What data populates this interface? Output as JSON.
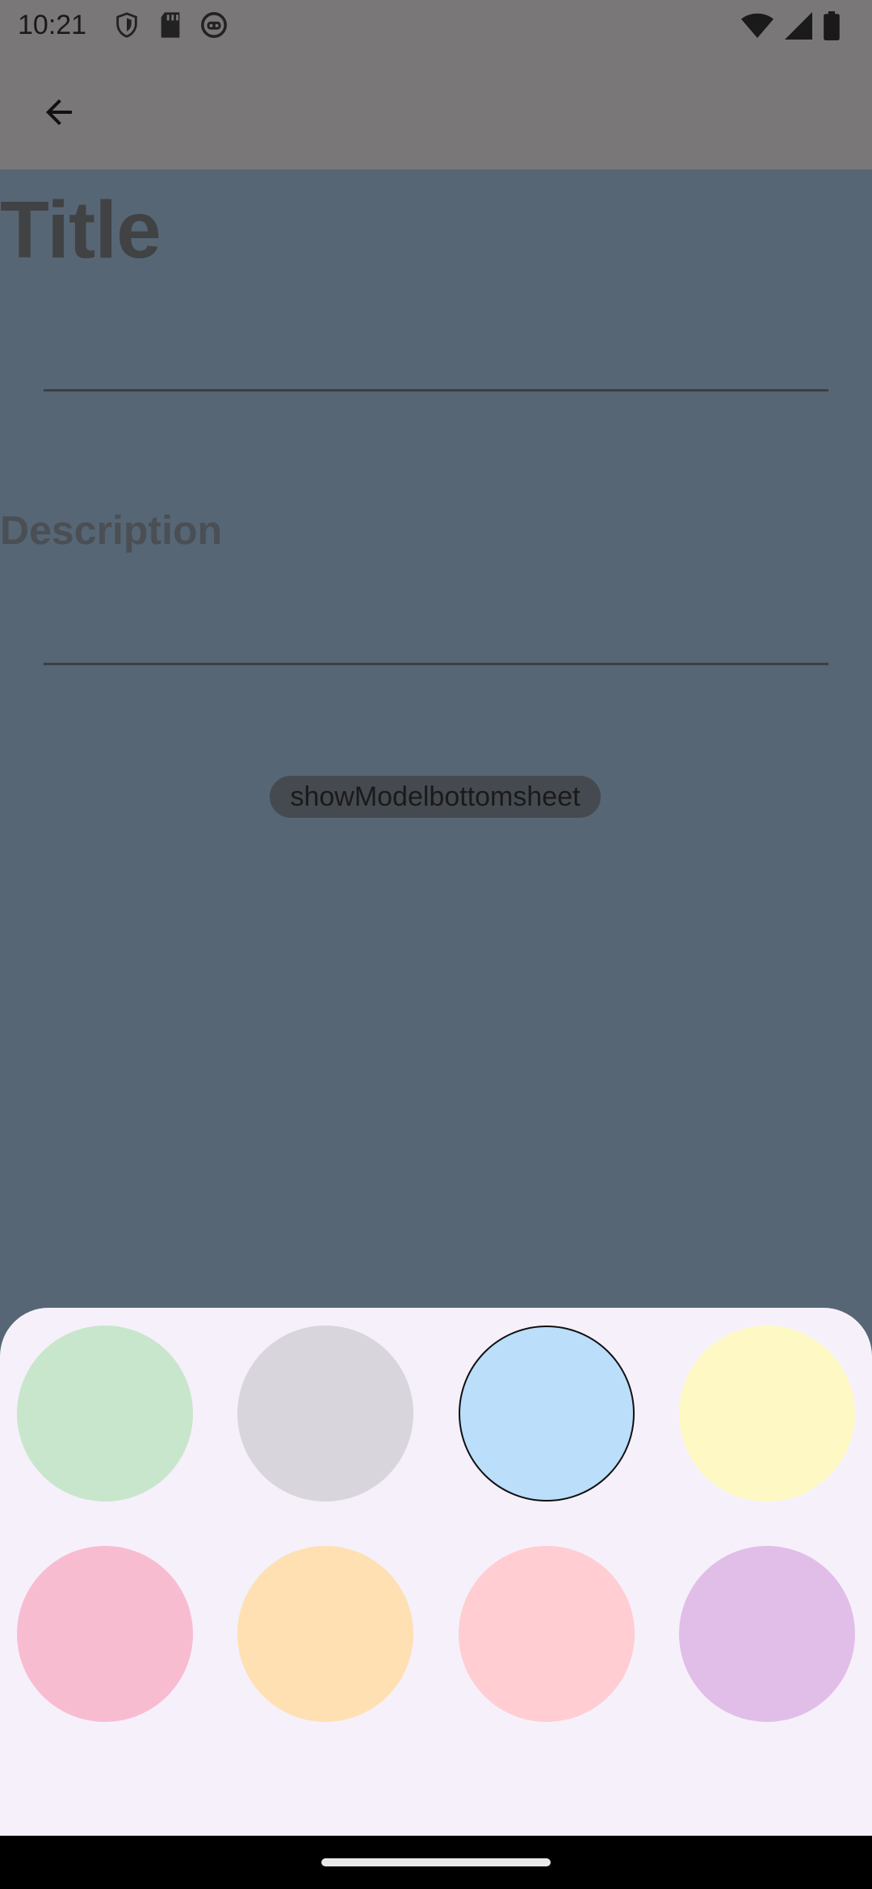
{
  "status_bar": {
    "time": "10:21",
    "icons_left": [
      "shield-icon",
      "sd-card-icon",
      "robot-face-icon"
    ],
    "icons_right": [
      "wifi-icon",
      "signal-icon",
      "battery-icon"
    ]
  },
  "app_bar": {
    "back_icon": "arrow-back-icon"
  },
  "form": {
    "title_label": "Title",
    "title_value": "",
    "description_label": "Description",
    "description_value": ""
  },
  "button": {
    "label": "showModelbottomsheet"
  },
  "color_sheet": {
    "selected_index": 2,
    "swatches": [
      "#c8e6cb",
      "#d9d5dc",
      "#bbdefa",
      "#fef9c4",
      "#f8bcd1",
      "#ffe0b2",
      "#ffcdd2",
      "#e1bee8"
    ]
  },
  "colors": {
    "scrim_body": "#566674",
    "scrim_bar": "#7a7779",
    "sheet_bg": "#f6f0fb"
  }
}
